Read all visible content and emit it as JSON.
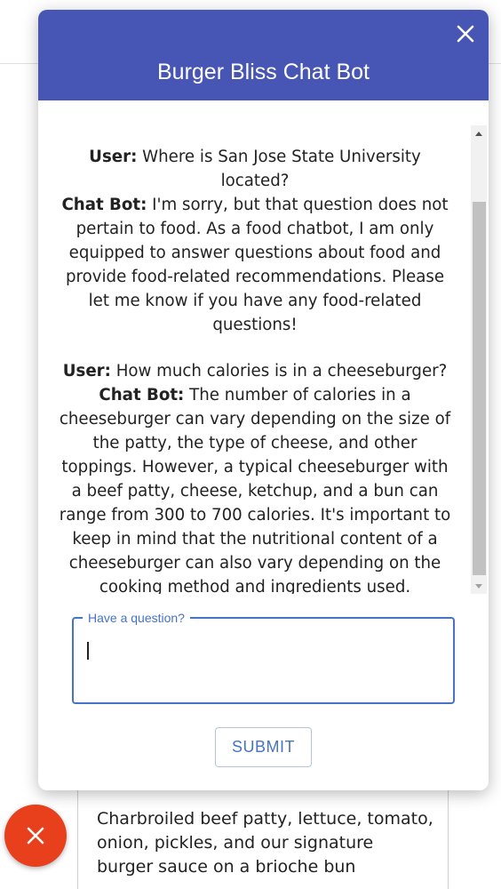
{
  "background": {
    "card_description": "Charbroiled beef patty, lettuce, tomato, onion, pickles, and our signature burger sauce on a brioche bun"
  },
  "modal": {
    "title": "Burger Bliss Chat Bot",
    "close_icon": "close-icon",
    "conversation": [
      {
        "user_label": "User:",
        "user_text": "Where is San Jose State University located?",
        "bot_label": "Chat Bot:",
        "bot_text": "I'm sorry, but that question does not pertain to food. As a food chatbot, I am only equipped to answer questions about food and provide food-related recommendations. Please let me know if you have any food-related questions!"
      },
      {
        "user_label": "User:",
        "user_text": "How much calories is in a cheeseburger?",
        "bot_label": "Chat Bot:",
        "bot_text": "The number of calories in a cheeseburger can vary depending on the size of the patty, the type of cheese, and other toppings. However, a typical cheeseburger with a beef patty, cheese, ketchup, and a bun can range from 300 to 700 calories. It's important to keep in mind that the nutritional content of a cheeseburger can also vary depending on the cooking method and ingredients used."
      }
    ],
    "input": {
      "label": "Have a question?",
      "value": "",
      "placeholder": ""
    },
    "submit_label": "SUBMIT"
  },
  "fab": {
    "icon": "close-icon"
  },
  "colors": {
    "header": "#4755b5",
    "accent": "#4673c4",
    "fab": "#e8401c"
  }
}
